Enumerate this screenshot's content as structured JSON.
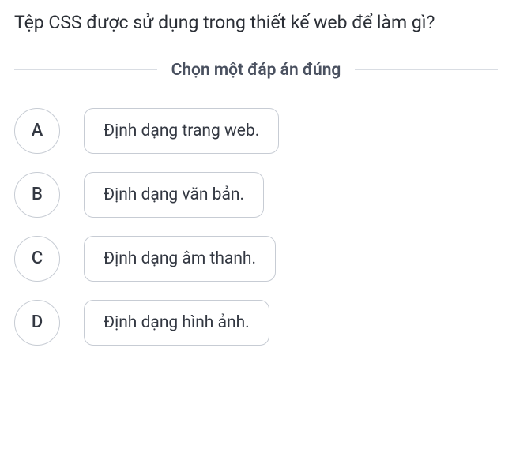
{
  "question": "Tệp CSS được sử dụng trong thiết kế web để làm gì?",
  "instruction": "Chọn một đáp án đúng",
  "options": [
    {
      "letter": "A",
      "text": "Định dạng trang web."
    },
    {
      "letter": "B",
      "text": "Định dạng văn bản."
    },
    {
      "letter": "C",
      "text": "Định dạng âm thanh."
    },
    {
      "letter": "D",
      "text": "Định dạng hình ảnh."
    }
  ]
}
